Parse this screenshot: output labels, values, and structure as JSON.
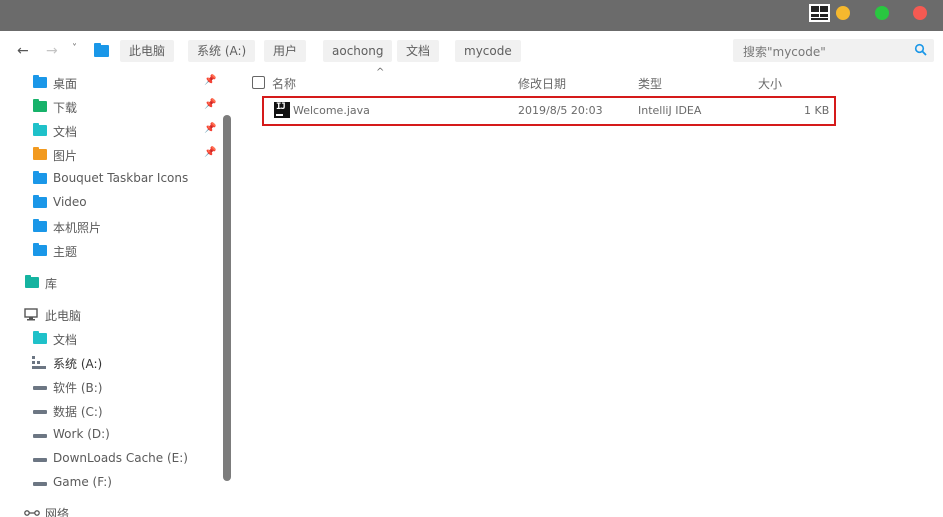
{
  "window": {
    "controls": [
      "taskbar-grid-icon",
      "minimize",
      "maximize",
      "close"
    ]
  },
  "addressbar": {
    "back_icon": "←",
    "forward_icon": "→",
    "recent_icon": "˅",
    "breadcrumbs": [
      "此电脑",
      "系统 (A:)",
      "用户",
      "aochong",
      "文档",
      "mycode"
    ],
    "search_placeholder": "搜索\"mycode\""
  },
  "sidebar": {
    "quick_access": [
      {
        "label": "桌面",
        "color": "#1a97e8",
        "pinned": true
      },
      {
        "label": "下载",
        "color": "#17b26a",
        "pinned": true
      },
      {
        "label": "文档",
        "color": "#1fc1c9",
        "pinned": true
      },
      {
        "label": "图片",
        "color": "#f29a1f",
        "pinned": true
      },
      {
        "label": "Bouquet Taskbar Icons",
        "color": "#1a97e8",
        "pinned": false
      },
      {
        "label": "Video",
        "color": "#1a97e8",
        "pinned": false
      },
      {
        "label": "本机照片",
        "color": "#1a97e8",
        "pinned": false
      },
      {
        "label": "主题",
        "color": "#1a97e8",
        "pinned": false
      }
    ],
    "library": {
      "label": "库",
      "color": "#15b3a0"
    },
    "this_pc": {
      "label": "此电脑"
    },
    "pc_items": [
      {
        "label": "文档",
        "type": "folder",
        "color": "#1fc1c9"
      },
      {
        "label": "系统 (A:)",
        "type": "system"
      },
      {
        "label": "软件 (B:)",
        "type": "drive"
      },
      {
        "label": "数据 (C:)",
        "type": "drive"
      },
      {
        "label": "Work (D:)",
        "type": "drive"
      },
      {
        "label": "DownLoads Cache (E:)",
        "type": "drive"
      },
      {
        "label": "Game (F:)",
        "type": "drive"
      }
    ],
    "network": {
      "label": "网络"
    },
    "pin_glyph": "📌"
  },
  "columns": {
    "name": "名称",
    "modified": "修改日期",
    "type": "类型",
    "size": "大小",
    "sort_indicator": "^"
  },
  "files": [
    {
      "icon": "intellij-idea-icon",
      "icon_text": "IJ",
      "name": "Welcome.java",
      "modified": "2019/8/5 20:03",
      "type": "IntelliJ IDEA",
      "size": "1 KB"
    }
  ]
}
